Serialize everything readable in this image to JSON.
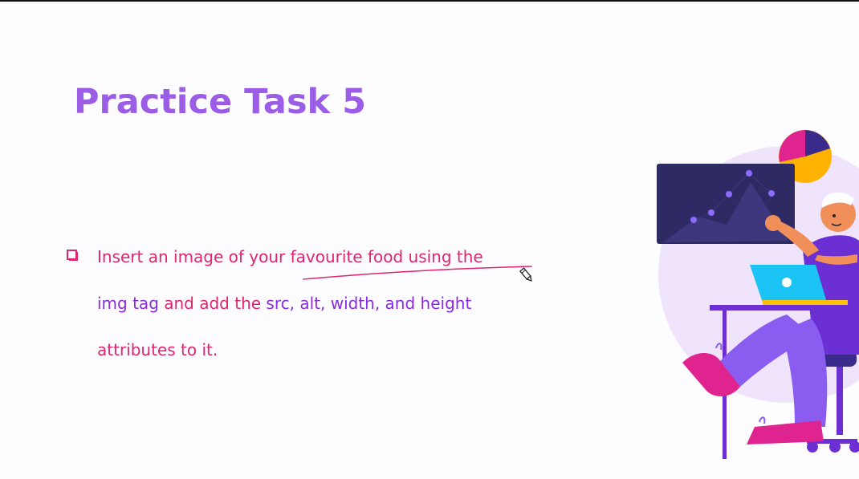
{
  "slide": {
    "title": "Practice Task 5",
    "bullets": [
      {
        "line1": "Insert an image of your favourite food using the",
        "line2_part1": "img tag ",
        "line2_part2": "and add the ",
        "line2_part3": "src, alt, width, ",
        "line2_part4": "and height",
        "line3": "attributes to it."
      }
    ]
  },
  "colors": {
    "title": "#9b5de5",
    "text_pink": "#e0246f",
    "text_purple": "#8a2be2",
    "background": "#fdfcfe"
  },
  "icons": {
    "bullet": "checkbox-square-icon",
    "cursor": "pen-cursor-icon",
    "illustration": "person-laptop-chart-illustration"
  }
}
